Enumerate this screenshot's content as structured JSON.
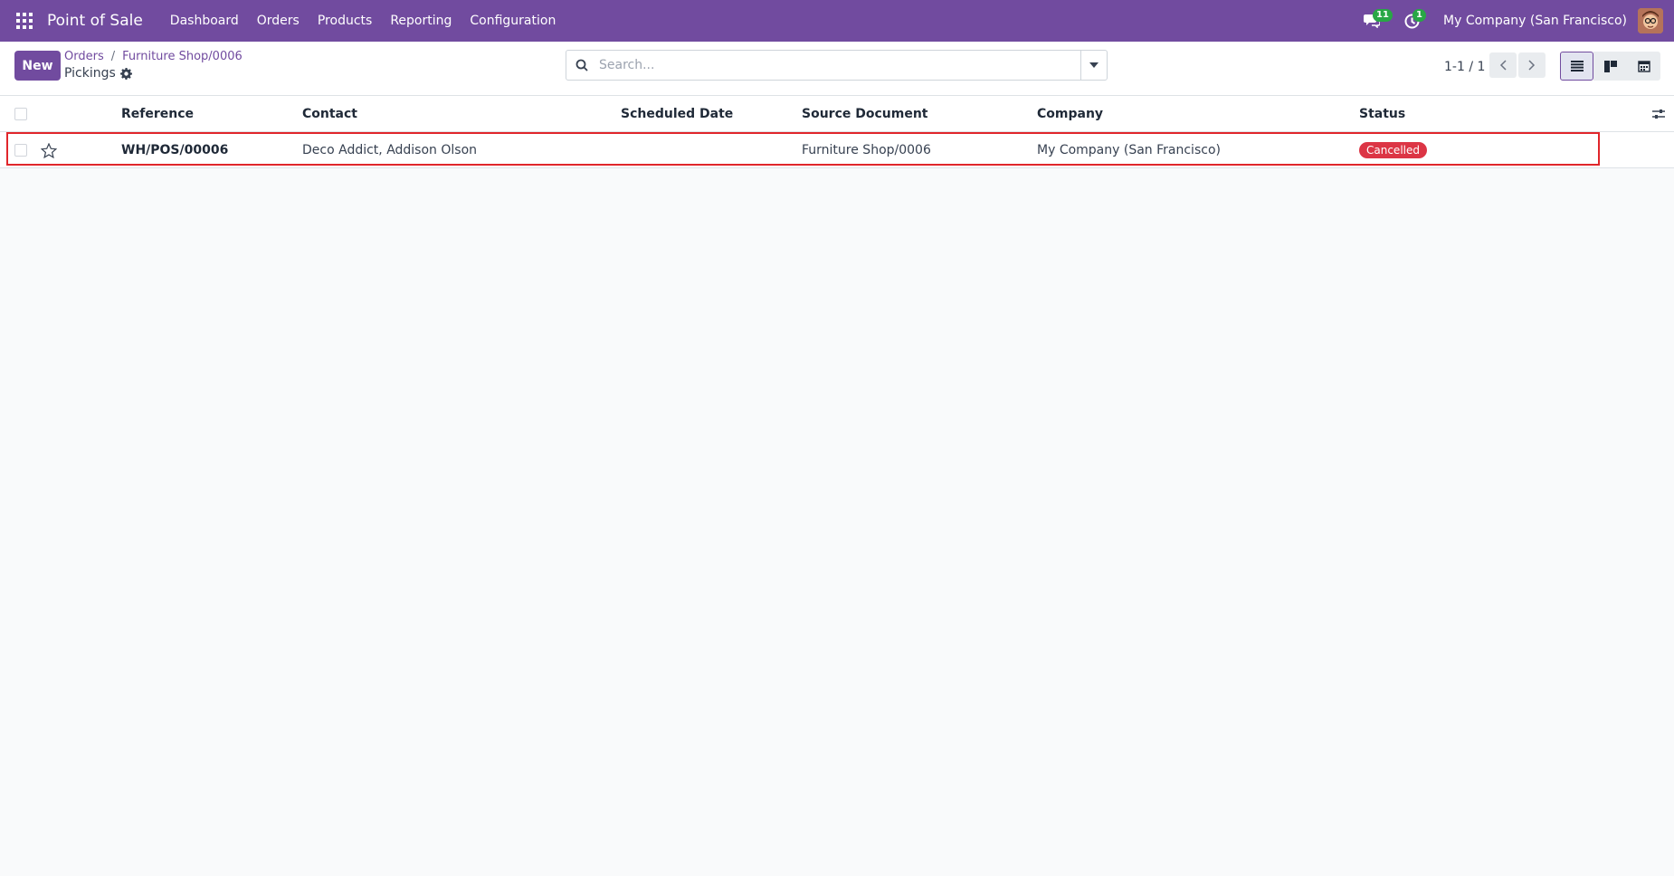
{
  "navbar": {
    "app_name": "Point of Sale",
    "menu": [
      "Dashboard",
      "Orders",
      "Products",
      "Reporting",
      "Configuration"
    ],
    "messages_count": "11",
    "activities_count": "1",
    "company": "My Company (San Francisco)"
  },
  "control": {
    "new_label": "New",
    "breadcrumb": [
      "Orders",
      "Furniture Shop/0006"
    ],
    "breadcrumb_sep": "/",
    "title": "Pickings",
    "search_placeholder": "Search...",
    "pager": "1-1 / 1"
  },
  "table": {
    "columns": [
      "Reference",
      "Contact",
      "Scheduled Date",
      "Source Document",
      "Company",
      "Status"
    ],
    "rows": [
      {
        "reference": "WH/POS/00006",
        "contact": "Deco Addict, Addison Olson",
        "scheduled_date": "",
        "source_document": "Furniture Shop/0006",
        "company": "My Company (San Francisco)",
        "status": "Cancelled"
      }
    ]
  },
  "colors": {
    "brand": "#714b9f",
    "status_cancelled": "#dc3545",
    "highlight": "#e0262b",
    "badge": "#28a745"
  }
}
